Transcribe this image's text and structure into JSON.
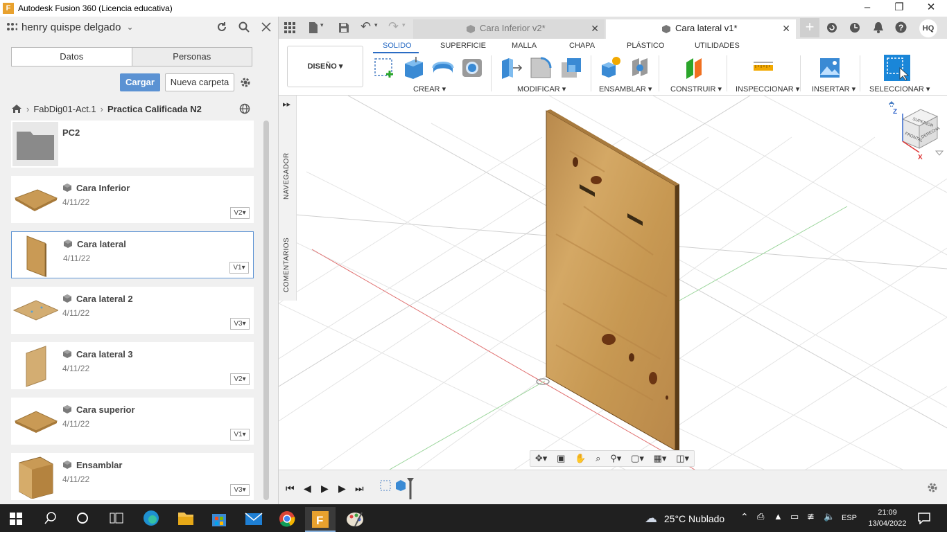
{
  "window": {
    "title": "Autodesk Fusion 360 (Licencia educativa)",
    "app_icon_letter": "F",
    "controls": [
      "minimize",
      "restore",
      "close"
    ]
  },
  "left_panel": {
    "username": "henry quispe delgado",
    "tabs": [
      "Datos",
      "Personas"
    ],
    "upload_label": "Cargar",
    "new_folder_label": "Nueva carpeta",
    "breadcrumb": [
      "FabDig01-Act.1",
      "Practica Calificada N2"
    ],
    "folder": {
      "name": "PC2"
    },
    "files": [
      {
        "name": "Cara Inferior",
        "date": "4/11/22",
        "version": "V2"
      },
      {
        "name": "Cara lateral",
        "date": "4/11/22",
        "version": "V1"
      },
      {
        "name": "Cara lateral 2",
        "date": "4/11/22",
        "version": "V3"
      },
      {
        "name": "Cara lateral 3",
        "date": "4/11/22",
        "version": "V2"
      },
      {
        "name": "Cara superior",
        "date": "4/11/22",
        "version": "V1"
      },
      {
        "name": "Ensamblar",
        "date": "4/11/22",
        "version": "V3"
      }
    ],
    "selected_file": "Cara lateral"
  },
  "doc_tabs": [
    {
      "label": "Cara Inferior v2*",
      "active": false
    },
    {
      "label": "Cara lateral v1*",
      "active": true
    }
  ],
  "user_initials": "HQ",
  "toolbar": {
    "workspace": "DISEÑO",
    "tabs": [
      "SOLIDO",
      "SUPERFICIE",
      "MALLA",
      "CHAPA",
      "PLÁSTICO",
      "UTILIDADES"
    ],
    "active_tab": "SOLIDO",
    "groups": [
      "CREAR",
      "MODIFICAR",
      "ENSAMBLAR",
      "CONSTRUIR",
      "INSPECCIONAR",
      "INSERTAR",
      "SELECCIONAR"
    ]
  },
  "viewport": {
    "side_labels": [
      "NAVEGADOR",
      "COMENTARIOS"
    ],
    "viewcube_faces": [
      "SUPERIOR",
      "FRONTAL",
      "DERECHA"
    ],
    "axes": [
      "Z",
      "X"
    ]
  },
  "taskbar": {
    "weather": "25°C  Nublado",
    "language": "ESP",
    "time": "21:09",
    "date": "13/04/2022"
  },
  "colors": {
    "accent": "#2a6cc4",
    "button_primary": "#5b92d3",
    "wood": "#c99a55",
    "taskbar": "#202020"
  }
}
